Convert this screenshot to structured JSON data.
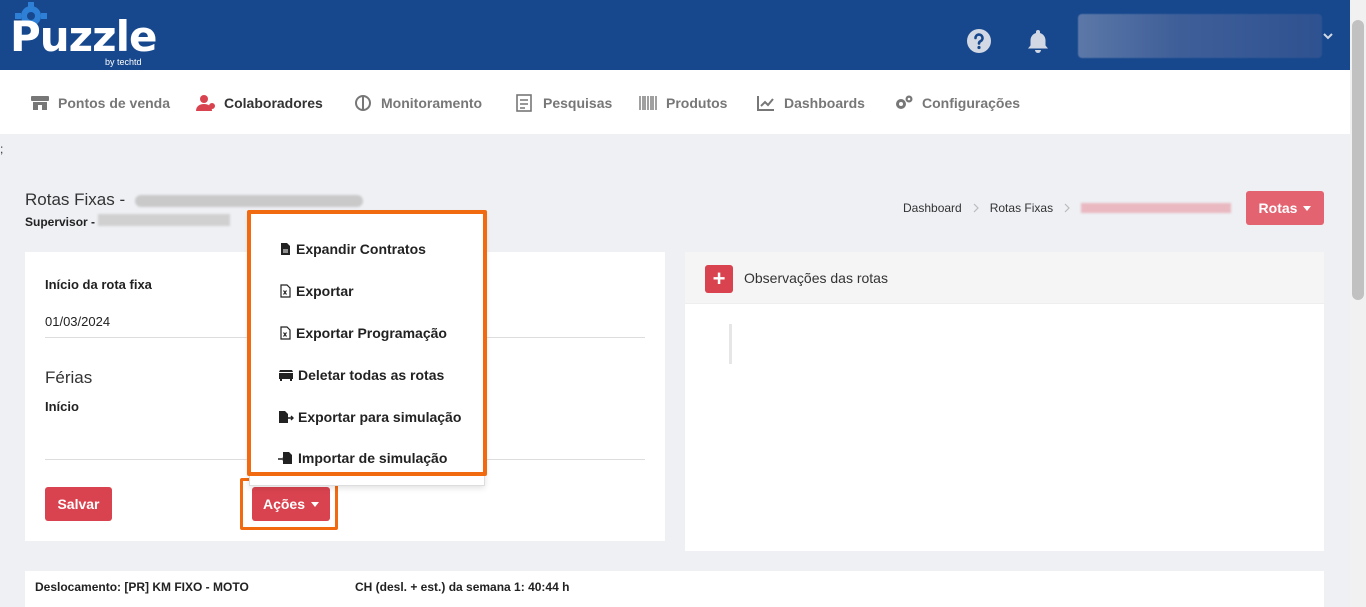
{
  "brand": {
    "name": "Puzzle",
    "sub": "by techtd"
  },
  "nav": {
    "items": [
      {
        "label": "Pontos de venda"
      },
      {
        "label": "Colaboradores"
      },
      {
        "label": "Monitoramento"
      },
      {
        "label": "Pesquisas"
      },
      {
        "label": "Produtos"
      },
      {
        "label": "Dashboards"
      },
      {
        "label": "Configurações"
      }
    ]
  },
  "stray_text": ";",
  "page": {
    "title": "Rotas Fixas -",
    "supervisor": "Supervisor -"
  },
  "breadcrumb": {
    "items": [
      "Dashboard",
      "Rotas Fixas"
    ]
  },
  "rotas_button": "Rotas",
  "form": {
    "inicio_rota_label": "Início da rota fixa",
    "inicio_rota_value": "01/03/2024",
    "ferias_heading": "Férias",
    "ferias_inicio_label": "Início",
    "save_label": "Salvar",
    "acoes_label": "Ações"
  },
  "menu": {
    "items": [
      {
        "label": "Expandir Contratos"
      },
      {
        "label": "Exportar"
      },
      {
        "label": "Exportar Programação"
      },
      {
        "label": "Deletar todas as rotas"
      },
      {
        "label": "Exportar para simulação"
      },
      {
        "label": "Importar de simulação"
      }
    ]
  },
  "observacoes": {
    "title": "Observações das rotas",
    "plus": "+"
  },
  "info": {
    "deslocamento": "Deslocamento: [PR] KM FIXO - MOTO",
    "ch_semana1": "CH (desl. + est.) da semana 1: 40:44 h"
  },
  "colors": {
    "header": "#17488e",
    "accent": "#d9434f",
    "highlight": "#f26a0f"
  }
}
